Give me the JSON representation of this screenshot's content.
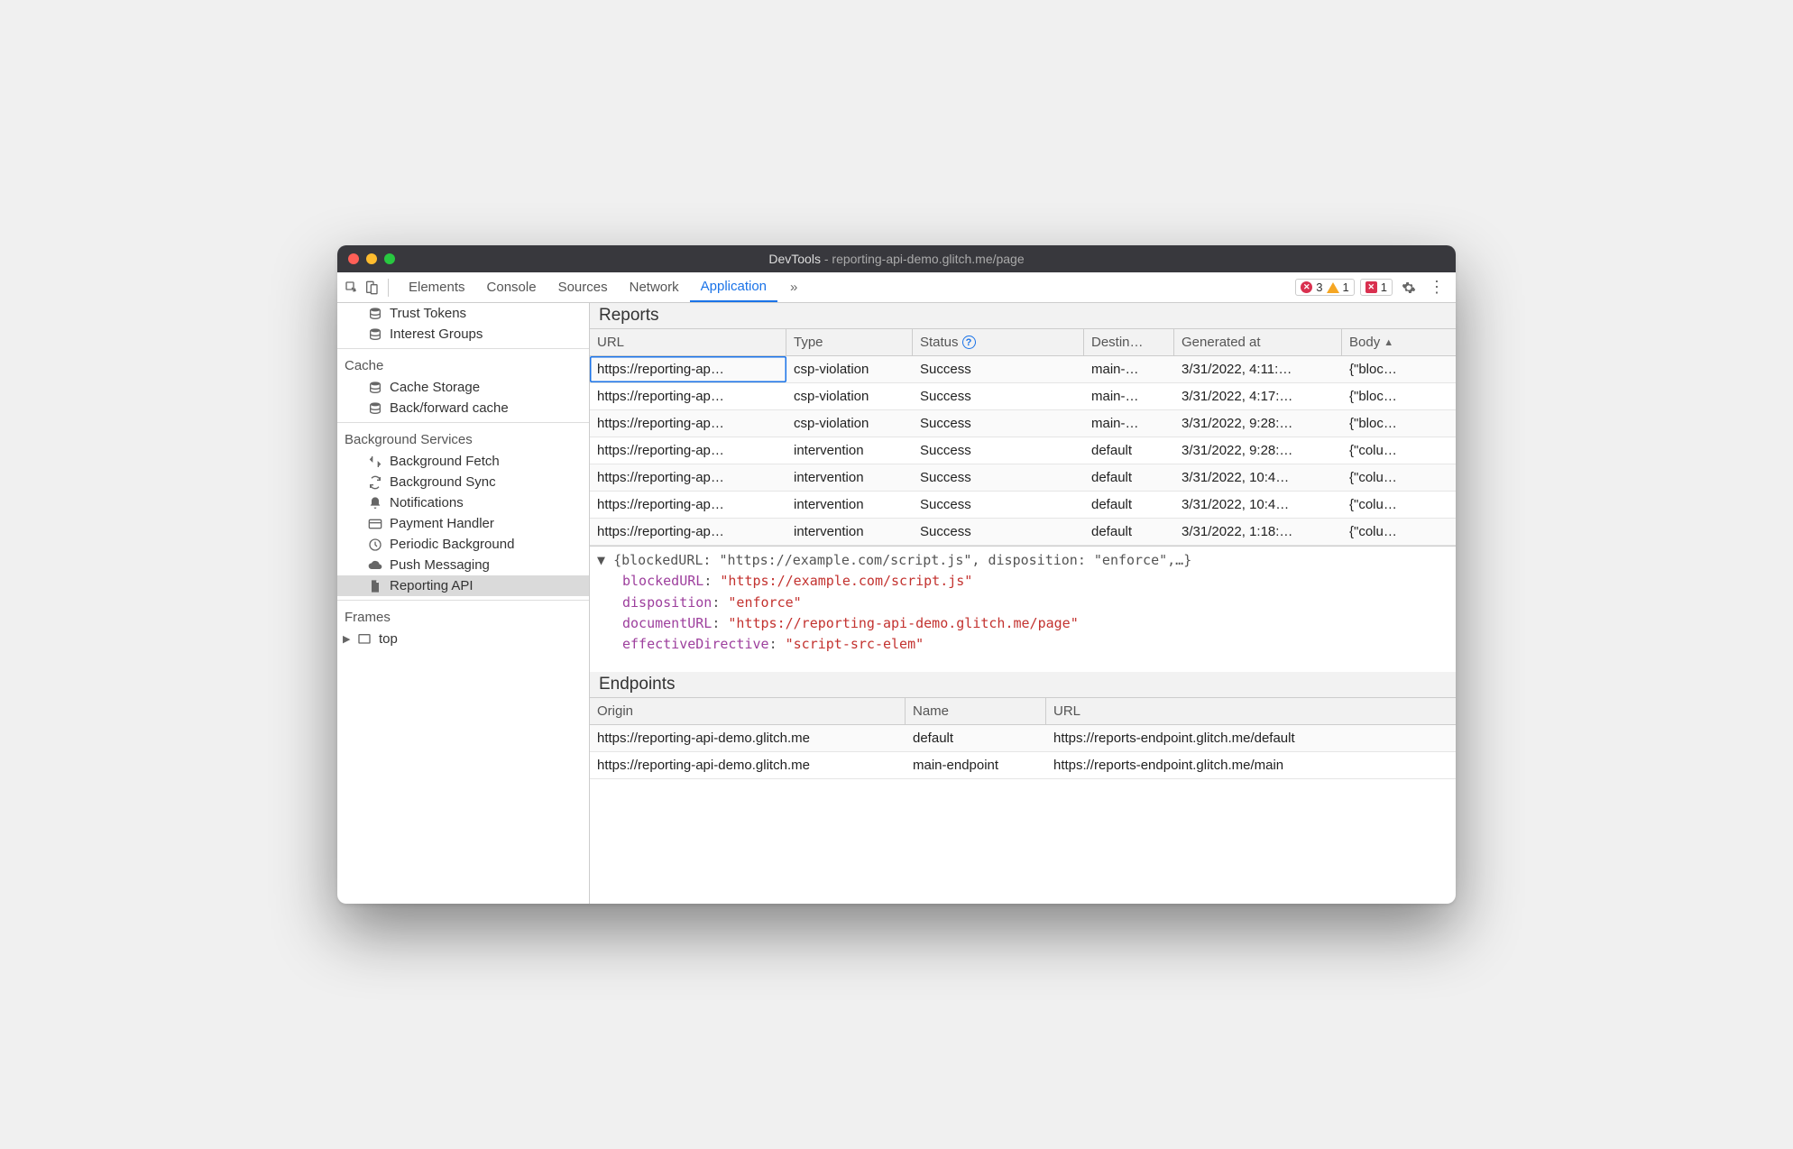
{
  "window": {
    "title": "DevTools",
    "subtitle": "reporting-api-demo.glitch.me/page"
  },
  "toolbar": {
    "tabs": [
      "Elements",
      "Console",
      "Sources",
      "Network",
      "Application"
    ],
    "active": "Application",
    "errors": "3",
    "warnings": "1",
    "issues": "1"
  },
  "sidebar": {
    "top_items": [
      {
        "label": "Trust Tokens",
        "icon": "db"
      },
      {
        "label": "Interest Groups",
        "icon": "db"
      }
    ],
    "groups": [
      {
        "title": "Cache",
        "items": [
          {
            "label": "Cache Storage",
            "icon": "db"
          },
          {
            "label": "Back/forward cache",
            "icon": "db"
          }
        ]
      },
      {
        "title": "Background Services",
        "items": [
          {
            "label": "Background Fetch",
            "icon": "fetch"
          },
          {
            "label": "Background Sync",
            "icon": "sync"
          },
          {
            "label": "Notifications",
            "icon": "bell"
          },
          {
            "label": "Payment Handler",
            "icon": "card"
          },
          {
            "label": "Periodic Background",
            "icon": "clock"
          },
          {
            "label": "Push Messaging",
            "icon": "cloud"
          },
          {
            "label": "Reporting API",
            "icon": "file",
            "selected": true
          }
        ]
      },
      {
        "title": "Frames",
        "items": [
          {
            "label": "top",
            "icon": "frame",
            "expandable": true
          }
        ]
      }
    ]
  },
  "reports": {
    "title": "Reports",
    "headers": {
      "url": "URL",
      "type": "Type",
      "status": "Status",
      "destination": "Destin…",
      "generated": "Generated at",
      "body": "Body"
    },
    "rows": [
      {
        "url": "https://reporting-ap…",
        "type": "csp-violation",
        "status": "Success",
        "dest": "main-…",
        "gen": "3/31/2022, 4:11:…",
        "body": "{\"bloc…",
        "selected": true
      },
      {
        "url": "https://reporting-ap…",
        "type": "csp-violation",
        "status": "Success",
        "dest": "main-…",
        "gen": "3/31/2022, 4:17:…",
        "body": "{\"bloc…"
      },
      {
        "url": "https://reporting-ap…",
        "type": "csp-violation",
        "status": "Success",
        "dest": "main-…",
        "gen": "3/31/2022, 9:28:…",
        "body": "{\"bloc…"
      },
      {
        "url": "https://reporting-ap…",
        "type": "intervention",
        "status": "Success",
        "dest": "default",
        "gen": "3/31/2022, 9:28:…",
        "body": "{\"colu…"
      },
      {
        "url": "https://reporting-ap…",
        "type": "intervention",
        "status": "Success",
        "dest": "default",
        "gen": "3/31/2022, 10:4…",
        "body": "{\"colu…"
      },
      {
        "url": "https://reporting-ap…",
        "type": "intervention",
        "status": "Success",
        "dest": "default",
        "gen": "3/31/2022, 10:4…",
        "body": "{\"colu…"
      },
      {
        "url": "https://reporting-ap…",
        "type": "intervention",
        "status": "Success",
        "dest": "default",
        "gen": "3/31/2022, 1:18:…",
        "body": "{\"colu…"
      }
    ]
  },
  "details": {
    "summary_open": "▼ ",
    "summary": "{blockedURL: \"https://example.com/script.js\", disposition: \"enforce\",…}",
    "lines": [
      {
        "key": "blockedURL",
        "val": "\"https://example.com/script.js\""
      },
      {
        "key": "disposition",
        "val": "\"enforce\""
      },
      {
        "key": "documentURL",
        "val": "\"https://reporting-api-demo.glitch.me/page\""
      },
      {
        "key": "effectiveDirective",
        "val": "\"script-src-elem\""
      }
    ]
  },
  "endpoints": {
    "title": "Endpoints",
    "headers": {
      "origin": "Origin",
      "name": "Name",
      "url": "URL"
    },
    "rows": [
      {
        "origin": "https://reporting-api-demo.glitch.me",
        "name": "default",
        "url": "https://reports-endpoint.glitch.me/default"
      },
      {
        "origin": "https://reporting-api-demo.glitch.me",
        "name": "main-endpoint",
        "url": "https://reports-endpoint.glitch.me/main"
      }
    ]
  }
}
